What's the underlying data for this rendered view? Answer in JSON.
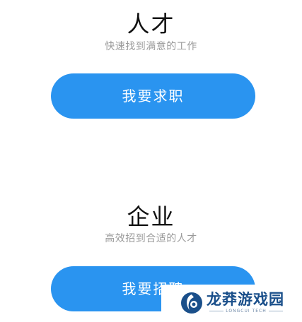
{
  "talent": {
    "title": "人才",
    "subtitle": "快速找到满意的工作",
    "button_label": "我要求职"
  },
  "company": {
    "title": "企业",
    "subtitle": "高效招到合适的人才",
    "button_label": "我要招聘"
  },
  "watermark": {
    "brand_text": "龙莽游戏园",
    "brand_subtext": "LONGCUI TECH"
  },
  "colors": {
    "accent": "#2a94f0",
    "title_text": "#111111",
    "subtitle_text": "#9a9a9a",
    "watermark_blue": "#1a4f8a"
  }
}
